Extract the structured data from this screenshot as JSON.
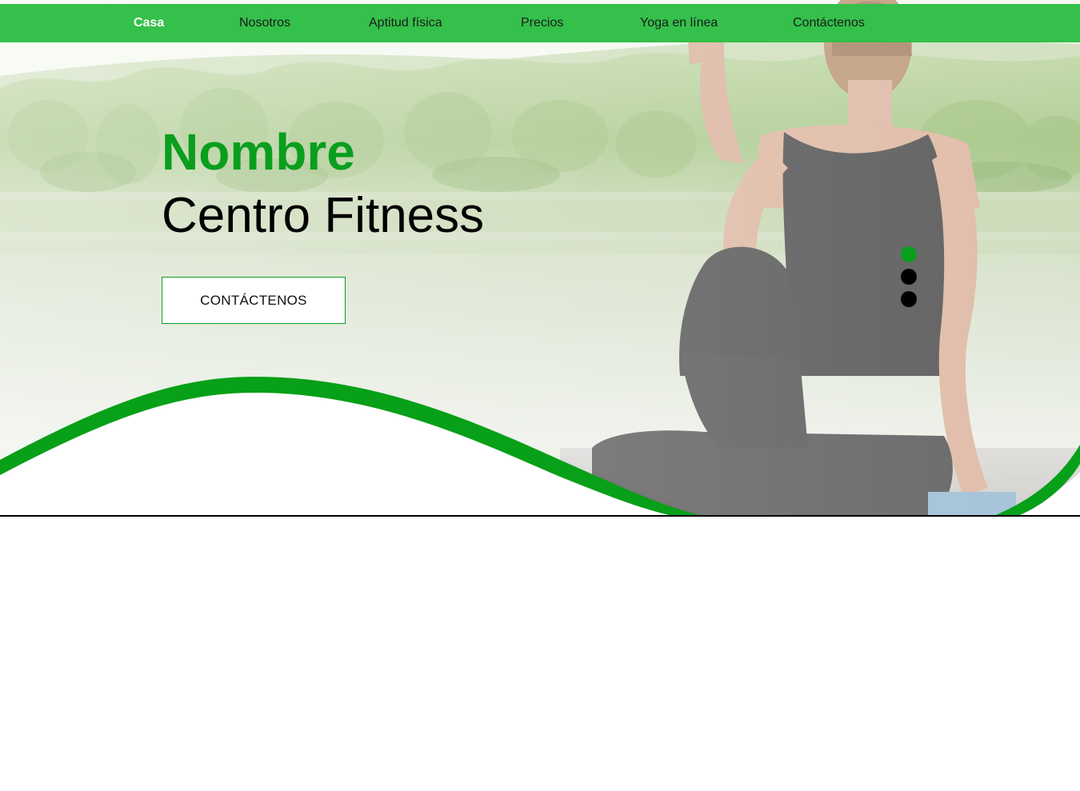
{
  "nav": {
    "items": [
      {
        "label": "Casa",
        "active": true
      },
      {
        "label": "Nosotros",
        "active": false
      },
      {
        "label": "Aptitud física",
        "active": false
      },
      {
        "label": "Precios",
        "active": false
      },
      {
        "label": "Yoga en línea",
        "active": false
      },
      {
        "label": "Contáctenos",
        "active": false
      }
    ]
  },
  "hero": {
    "title_line1": "Nombre",
    "title_line2": "Centro Fitness",
    "cta_label": "CONTÁCTENOS",
    "slider_dots": {
      "count": 3,
      "active_index": 0
    }
  },
  "colors": {
    "nav_background": "#34c04a",
    "accent_green": "#0a9e1e",
    "nav_text": "#1b1b1b",
    "nav_active_text": "#ffffff",
    "dot_inactive": "#000000"
  }
}
